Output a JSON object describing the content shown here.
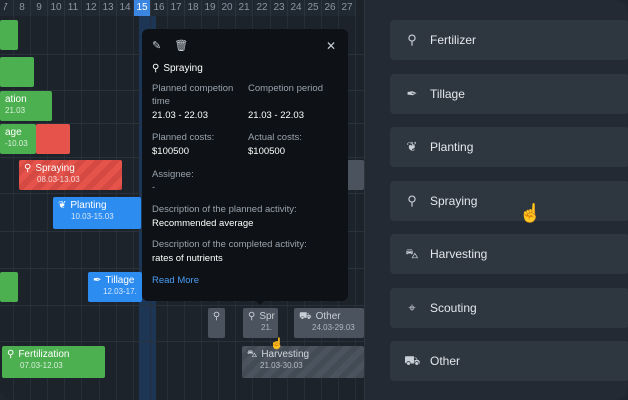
{
  "timeline": {
    "days": [
      "7",
      "8",
      "9",
      "10",
      "11",
      "12",
      "13",
      "14",
      "15",
      "16",
      "17",
      "18",
      "19",
      "20",
      "21",
      "22",
      "23",
      "24",
      "25",
      "26",
      "27"
    ],
    "today": "15",
    "bars": [
      {
        "title": "",
        "dates": ""
      },
      {
        "title": "",
        "dates": ""
      },
      {
        "title": "ation",
        "dates": "21.03"
      },
      {
        "title": "age",
        "dates": "-10.03"
      },
      {
        "title": "Spraying",
        "dates": "08.03-13.03"
      },
      {
        "title": "Planting",
        "dates": "10.03-15.03"
      },
      {
        "title": "Tillage",
        "dates": "12.03-17."
      },
      {
        "title": "Spr",
        "dates": "21."
      },
      {
        "title": "Other",
        "dates": "24.03-29.03"
      },
      {
        "title": "Fertilization",
        "dates": "07.03-12.03"
      },
      {
        "title": "Harvesting",
        "dates": "21.03-30.03"
      }
    ]
  },
  "popup": {
    "edit_icon": "pencil-icon",
    "delete_icon": "trash-icon",
    "close_icon": "close-icon",
    "title": "Spraying",
    "planned_completion_label": "Planned competion time",
    "planned_completion_value": "21.03 - 22.03",
    "completion_period_label": "Competion period",
    "completion_period_value": "21.03 - 22.03",
    "planned_costs_label": "Planned costs:",
    "planned_costs_value": "$100500",
    "actual_costs_label": "Actual costs:",
    "actual_costs_value": "$100500",
    "assignee_label": "Assignee:",
    "assignee_value": "-",
    "planned_desc_label": "Description of the planned activity:",
    "planned_desc_value": "Recommended average",
    "completed_desc_label": "Description of the completed activity:",
    "completed_desc_value": "rates of nutrients",
    "read_more": "Read More"
  },
  "panel": {
    "items": [
      {
        "label": "Fertilizer",
        "icon": "fertilizer-icon"
      },
      {
        "label": "Tillage",
        "icon": "tillage-icon"
      },
      {
        "label": "Planting",
        "icon": "planting-icon"
      },
      {
        "label": "Spraying",
        "icon": "spraying-icon"
      },
      {
        "label": "Harvesting",
        "icon": "harvesting-icon"
      },
      {
        "label": "Scouting",
        "icon": "scouting-icon"
      },
      {
        "label": "Other",
        "icon": "other-icon"
      }
    ]
  }
}
